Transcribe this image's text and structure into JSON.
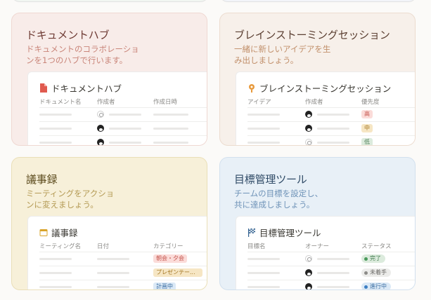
{
  "colors": {
    "red_bg": "#f8ece9",
    "red_border": "#efd8d2",
    "red_title": "#6e3a33",
    "red_text": "#c98579",
    "orange_bg": "#f7f0ea",
    "orange_border": "#ecdccf",
    "orange_title": "#5c4033",
    "orange_text": "#c18f6a",
    "yellow_bg": "#f7f0d9",
    "yellow_border": "#eadfb8",
    "yellow_title": "#5b4a1c",
    "yellow_text": "#b49a54",
    "blue_bg": "#e8f0f7",
    "blue_border": "#d2e0ee",
    "blue_title": "#2f4a66",
    "blue_text": "#6f93b8"
  },
  "cards": {
    "docs": {
      "title": "ドキュメントハブ",
      "desc": "ドキュメントのコラボレーションを1つのハブで行います。",
      "preview_title": "ドキュメントハブ",
      "preview_icon": "document-icon",
      "columns": [
        "ドキュメント名",
        "作成者",
        "作成日時"
      ]
    },
    "brainstorm": {
      "title": "ブレインストーミングセッション",
      "desc": "一緒に新しいアイデアを生み出しましょう。",
      "preview_title": "ブレインストーミングセッション",
      "preview_icon": "lightbulb-pin-icon",
      "columns": [
        "アイデア",
        "作成者",
        "優先度"
      ],
      "priorities": [
        "高",
        "中",
        "低"
      ]
    },
    "minutes": {
      "title": "議事録",
      "desc": "ミーティングをアクションに変えましょう。",
      "preview_title": "議事録",
      "preview_icon": "calendar-icon",
      "columns": [
        "ミーティング名",
        "日付",
        "カテゴリー"
      ],
      "categories": [
        "朝会・夕会",
        "プレゼンテー...",
        "計画中"
      ]
    },
    "goals": {
      "title": "目標管理ツール",
      "desc": "チームの目標を設定し、共に達成しましょう。",
      "preview_title": "目標管理ツール",
      "preview_icon": "flag-icon",
      "columns": [
        "目標名",
        "オーナー",
        "ステータス"
      ],
      "statuses": [
        "完了",
        "未着手",
        "進行中"
      ]
    }
  }
}
